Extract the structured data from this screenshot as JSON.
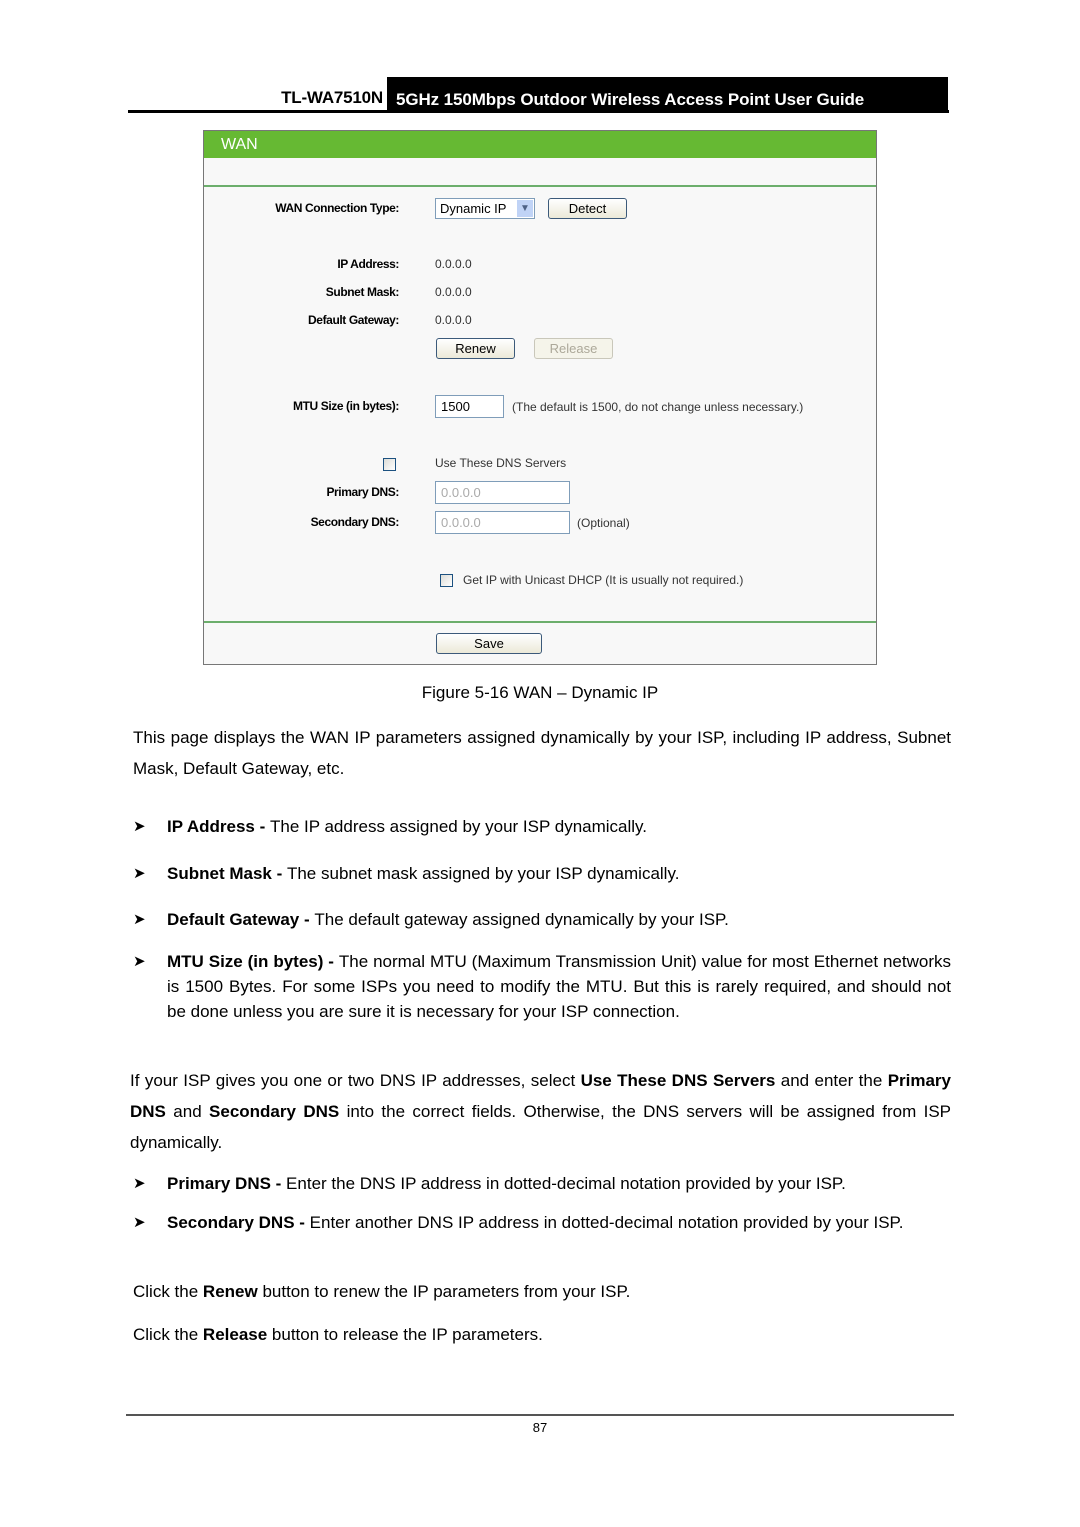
{
  "header": {
    "model": "TL-WA7510N",
    "title": "5GHz 150Mbps Outdoor Wireless Access Point User Guide"
  },
  "wan_panel": {
    "title": "WAN",
    "connection_type_label": "WAN Connection Type:",
    "connection_type_value": "Dynamic IP",
    "detect_button": "Detect",
    "ip_address_label": "IP Address:",
    "ip_address_value": "0.0.0.0",
    "subnet_mask_label": "Subnet Mask:",
    "subnet_mask_value": "0.0.0.0",
    "gateway_label": "Default Gateway:",
    "gateway_value": "0.0.0.0",
    "renew_button": "Renew",
    "release_button": "Release",
    "mtu_label": "MTU Size (in bytes):",
    "mtu_value": "1500",
    "mtu_note": "(The default is 1500, do not change unless necessary.)",
    "use_dns_label": "Use These DNS Servers",
    "use_dns_checked": false,
    "primary_dns_label": "Primary DNS:",
    "primary_dns_value": "0.0.0.0",
    "secondary_dns_label": "Secondary DNS:",
    "secondary_dns_value": "0.0.0.0",
    "secondary_dns_note": "(Optional)",
    "unicast_label": "Get IP with Unicast DHCP (It is usually not required.)",
    "unicast_checked": false,
    "save_button": "Save"
  },
  "figure_caption": "Figure 5-16 WAN – Dynamic IP",
  "intro": "This page displays the WAN IP parameters assigned dynamically by your ISP, including IP address, Subnet Mask, Default Gateway, etc.",
  "bullets1": [
    {
      "term": "IP Address - ",
      "text": "The IP address assigned by your ISP dynamically."
    },
    {
      "term": "Subnet Mask - ",
      "text": "The subnet mask assigned by your ISP dynamically."
    },
    {
      "term": "Default Gateway - ",
      "text": "The default gateway assigned dynamically by your ISP."
    },
    {
      "term": "MTU Size (in bytes) - ",
      "text": "The normal MTU (Maximum Transmission Unit) value for most Ethernet networks is 1500 Bytes. For some ISPs you need to modify the MTU. But this is rarely required, and should not be done unless you are sure it is necessary for your ISP connection."
    }
  ],
  "dns_para": {
    "p1": "If your ISP gives you one or two DNS IP addresses, select ",
    "b1": "Use These DNS Servers",
    "p2": " and enter the ",
    "b2": "Primary DNS",
    "p3": " and ",
    "b3": "Secondary DNS",
    "p4": " into the correct fields. Otherwise, the DNS servers will be assigned from ISP dynamically."
  },
  "bullets2": [
    {
      "term": "Primary DNS - ",
      "text": "Enter the DNS IP address in dotted-decimal notation provided by your ISP."
    },
    {
      "term": "Secondary DNS - ",
      "text": "Enter another DNS IP address in dotted-decimal notation provided by your ISP."
    }
  ],
  "renew_para": {
    "p1": "Click the ",
    "b": "Renew",
    "p2": " button to renew the IP parameters from your ISP."
  },
  "release_para": {
    "p1": "Click the ",
    "b": "Release",
    "p2": " button to release the IP parameters."
  },
  "page_number": "87",
  "bullet_icon": "arrowhead-bullet-icon"
}
